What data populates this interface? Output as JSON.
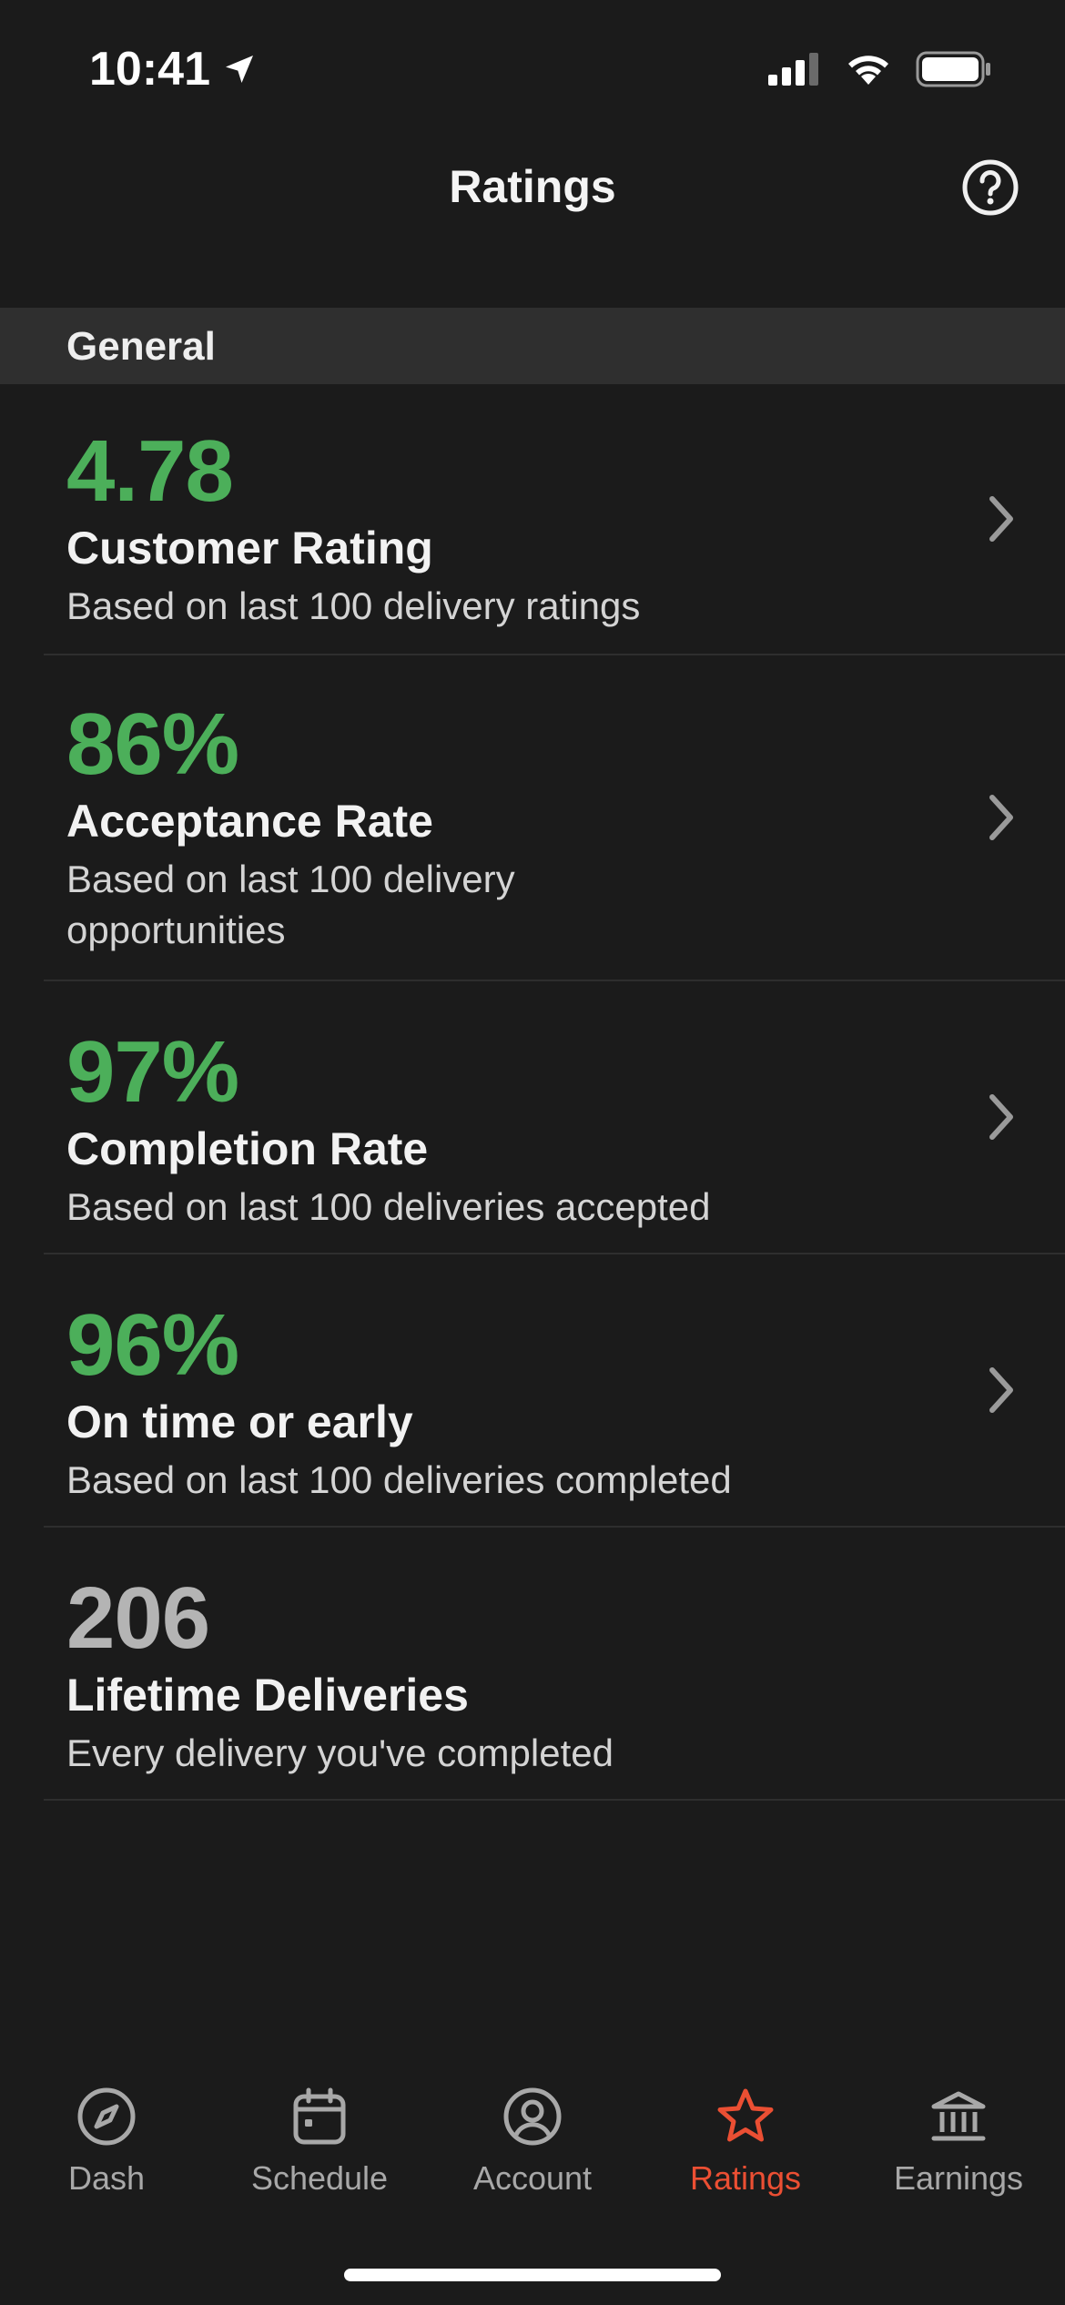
{
  "status_bar": {
    "time": "10:41"
  },
  "header": {
    "title": "Ratings"
  },
  "section": {
    "title": "General"
  },
  "metrics": [
    {
      "value": "4.78",
      "label": "Customer Rating",
      "description": "Based on last 100 delivery ratings"
    },
    {
      "value": "86%",
      "label": "Acceptance Rate",
      "description": "Based on last 100 delivery opportunities"
    },
    {
      "value": "97%",
      "label": "Completion Rate",
      "description": "Based on last 100 deliveries accepted"
    },
    {
      "value": "96%",
      "label": "On time or early",
      "description": "Based on last 100 deliveries completed"
    },
    {
      "value": "206",
      "label": "Lifetime Deliveries",
      "description": "Every delivery you've completed"
    }
  ],
  "tabs": [
    {
      "label": "Dash",
      "icon": "compass-icon"
    },
    {
      "label": "Schedule",
      "icon": "calendar-icon"
    },
    {
      "label": "Account",
      "icon": "user-circle-icon"
    },
    {
      "label": "Ratings",
      "icon": "star-icon",
      "active": true
    },
    {
      "label": "Earnings",
      "icon": "bank-icon"
    }
  ],
  "colors": {
    "background": "#1b1b1b",
    "section_header": "#2f2f2f",
    "positive_value": "#4caf5a",
    "neutral_value": "#b4b4b4",
    "active_tab": "#eb4f33",
    "inactive_tab": "#a8a8a8"
  }
}
